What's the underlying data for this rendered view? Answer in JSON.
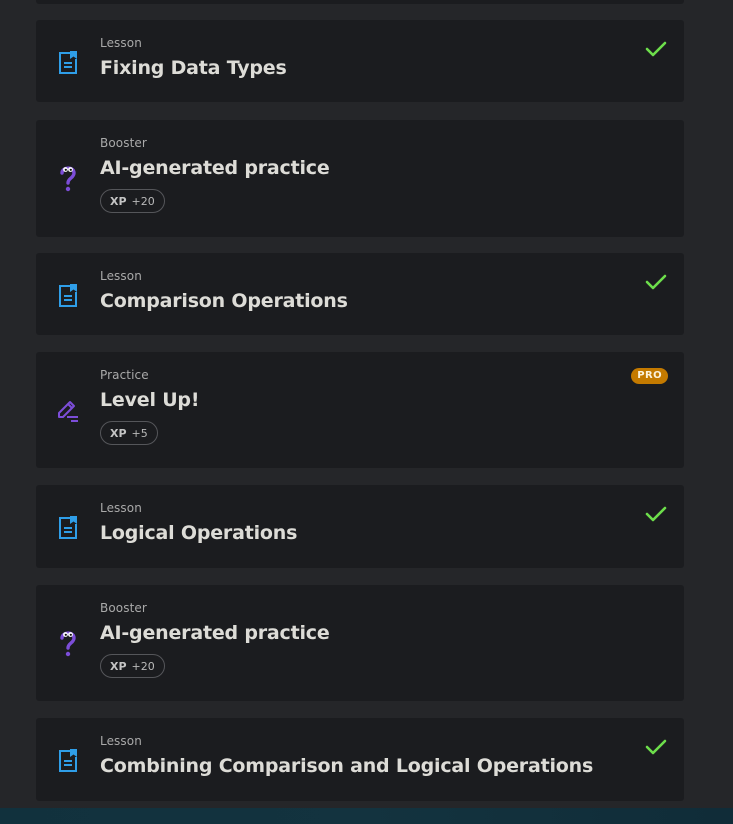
{
  "items": [
    {
      "type": "Lesson",
      "title": "Fixing Data Types",
      "icon": "lesson-icon",
      "completed": true
    },
    {
      "type": "Booster",
      "title": "AI-generated practice",
      "icon": "booster-question-icon",
      "xp_label": "XP",
      "xp_value": "+20"
    },
    {
      "type": "Lesson",
      "title": "Comparison Operations",
      "icon": "lesson-icon",
      "completed": true
    },
    {
      "type": "Practice",
      "title": "Level Up!",
      "icon": "pencil-icon",
      "xp_label": "XP",
      "xp_value": "+5",
      "badge": "PRO"
    },
    {
      "type": "Lesson",
      "title": "Logical Operations",
      "icon": "lesson-icon",
      "completed": true
    },
    {
      "type": "Booster",
      "title": "AI-generated practice",
      "icon": "booster-question-icon",
      "xp_label": "XP",
      "xp_value": "+20"
    },
    {
      "type": "Lesson",
      "title": "Combining Comparison and Logical Operations",
      "icon": "lesson-icon",
      "completed": true
    }
  ],
  "colors": {
    "background": "#252629",
    "card": "#1b1c1f",
    "lesson_icon": "#2f9ee8",
    "booster_icon": "#7c4dd8",
    "check": "#6dde4b",
    "pro_badge": "#c47a00"
  }
}
